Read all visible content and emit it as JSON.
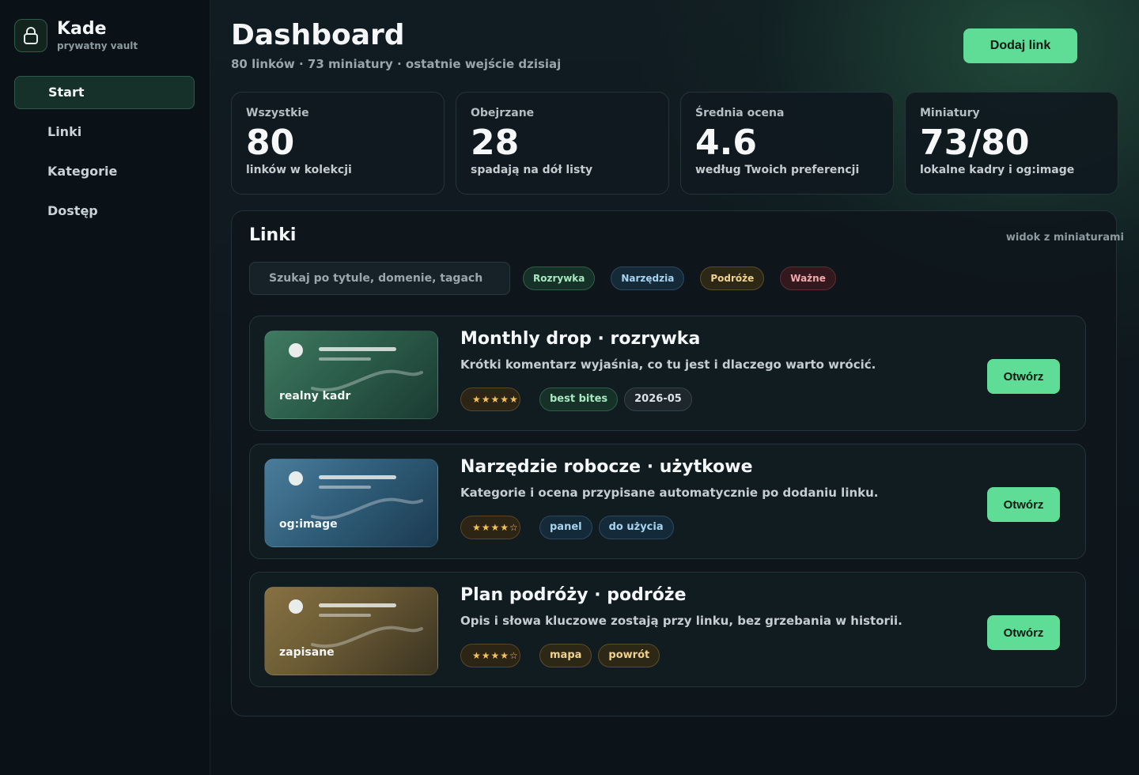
{
  "brand": {
    "name": "Kade",
    "subtitle": "prywatny vault"
  },
  "sidebar": {
    "items": [
      {
        "label": "Start",
        "active": true
      },
      {
        "label": "Linki",
        "active": false
      },
      {
        "label": "Kategorie",
        "active": false
      },
      {
        "label": "Dostęp",
        "active": false
      }
    ]
  },
  "header": {
    "title": "Dashboard",
    "subtitle": "80 linków · 73 miniatury · ostatnie wejście dzisiaj",
    "add_label": "Dodaj link"
  },
  "stats": [
    {
      "label": "Wszystkie",
      "value": "80",
      "desc": "linków w kolekcji"
    },
    {
      "label": "Obejrzane",
      "value": "28",
      "desc": "spadają na dół listy"
    },
    {
      "label": "Średnia ocena",
      "value": "4.6",
      "desc": "według Twoich preferencji"
    },
    {
      "label": "Miniatury",
      "value": "73/80",
      "desc": "lokalne kadry i og:image"
    }
  ],
  "links_panel": {
    "title": "Linki",
    "mode": "widok z miniaturami",
    "search_placeholder": "Szukaj po tytule, domenie, tagach",
    "filters": [
      "Rozrywka",
      "Narzędzia",
      "Podróże",
      "Ważne"
    ],
    "open_label": "Otwórz",
    "items": [
      {
        "thumb_label": "realny kadr",
        "title": "Monthly drop · rozrywka",
        "desc": "Krótki komentarz wyjaśnia, co tu jest i dlaczego warto wrócić.",
        "stars": "★★★★★",
        "tags": [
          "best bites",
          "2026-05"
        ]
      },
      {
        "thumb_label": "og:image",
        "title": "Narzędzie robocze · użytkowe",
        "desc": "Kategorie i ocena przypisane automatycznie po dodaniu linku.",
        "stars": "★★★★☆",
        "tags": [
          "panel",
          "do użycia"
        ]
      },
      {
        "thumb_label": "zapisane",
        "title": "Plan podróży · podróże",
        "desc": "Opis i słowa kluczowe zostają przy linku, bez grzebania w historii.",
        "stars": "★★★★☆",
        "tags": [
          "mapa",
          "powrót"
        ]
      }
    ]
  },
  "colors": {
    "accent": "#5fdd97",
    "background": "#0c141a",
    "sidebar": "#0a1217"
  }
}
